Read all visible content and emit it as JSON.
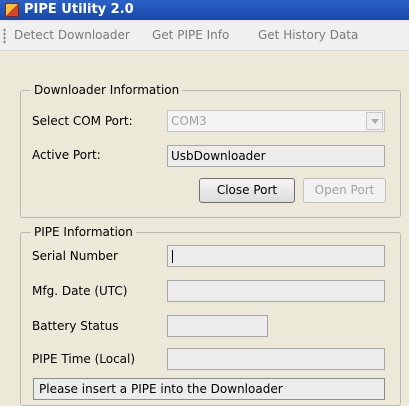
{
  "window": {
    "title": "PIPE Utility 2.0"
  },
  "menu": [
    {
      "label": "Detect Downloader"
    },
    {
      "label": "Get PIPE Info"
    },
    {
      "label": "Get History Data"
    }
  ],
  "downloader_info": {
    "title": "Downloader Information",
    "com_port_label": "Select COM Port:",
    "com_port_value": "COM3",
    "active_port_label": "Active Port:",
    "active_port_value": "UsbDownloader",
    "close_port_label": "Close Port",
    "open_port_label": "Open Port"
  },
  "pipe_info": {
    "title": "PIPE Information",
    "serial_number_label": "Serial Number",
    "serial_number_value": "",
    "mfg_date_label": "Mfg. Date (UTC)",
    "mfg_date_value": "",
    "battery_status_label": "Battery Status",
    "battery_status_value": "",
    "pipe_time_label": "PIPE Time (Local)",
    "pipe_time_value": "",
    "status_message": "Please insert a PIPE into the Downloader"
  }
}
